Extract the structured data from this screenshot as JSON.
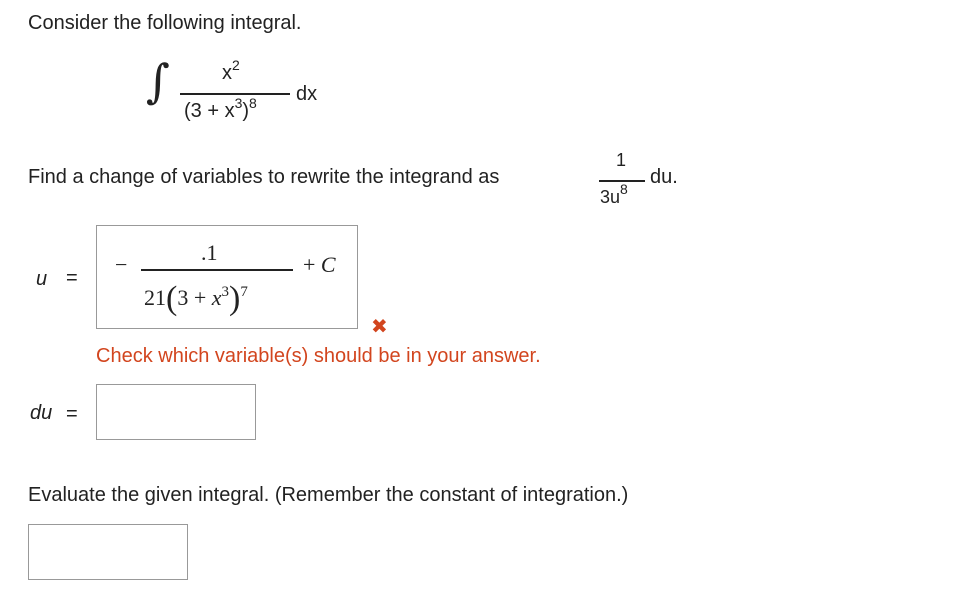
{
  "question": {
    "intro": "Consider the following integral.",
    "integral": {
      "numerator_base": "x",
      "numerator_exp": "2",
      "denominator_left": "(3 + ",
      "denominator_var": "x",
      "denominator_inner_exp": "3",
      "denominator_close": ")",
      "denominator_exp": "8",
      "differential": "dx"
    },
    "instruction": "Find a change of variables to rewrite the integrand as",
    "target": {
      "numerator": "1",
      "denominator_coef": "3",
      "denominator_var": "u",
      "denominator_exp": "8",
      "differential": "du."
    }
  },
  "u_field": {
    "label": "u",
    "equals": "=",
    "answer": {
      "minus": "−",
      "numerator": ".1",
      "den_coef": "21",
      "den_open": "(",
      "den_three": "3",
      "den_plus": "+",
      "den_var": "x",
      "den_inner_exp": "3",
      "den_close": ")",
      "den_exp": "7",
      "plus": "+",
      "constant": "C"
    },
    "status_icon": "✖",
    "feedback": "Check which variable(s) should be in your answer."
  },
  "du_field": {
    "label": "du",
    "equals": "=",
    "value": ""
  },
  "evaluate": {
    "instruction": "Evaluate the given integral. (Remember the constant of integration.)",
    "value": ""
  },
  "colors": {
    "error": "#d2451e",
    "text": "#222222",
    "box_border": "#999999"
  }
}
